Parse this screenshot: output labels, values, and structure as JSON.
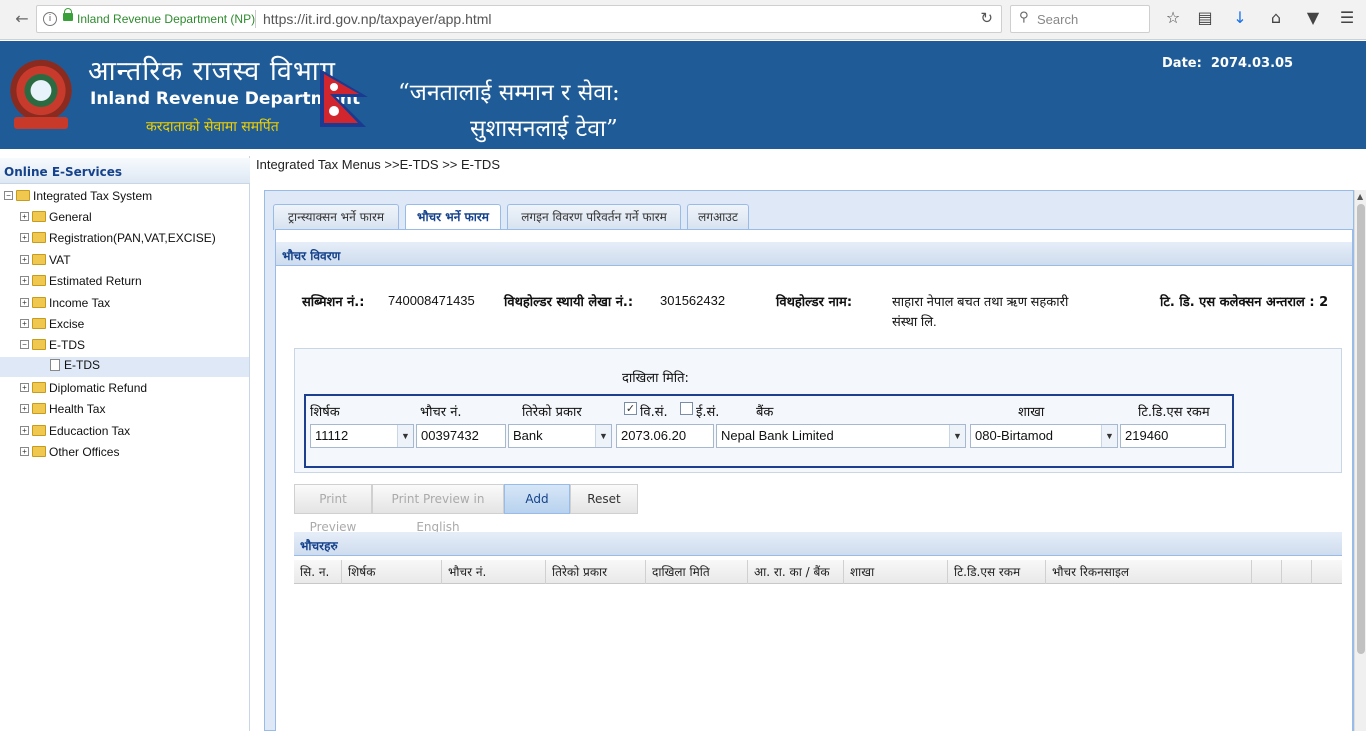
{
  "browser": {
    "site_identity": "Inland Revenue Department (NP)",
    "url": "https://it.ird.gov.np/taxpayer/app.html",
    "search_placeholder": "Search"
  },
  "header": {
    "title_np": "आन्तरिक राजस्व विभाग",
    "title_en": "Inland Revenue Department",
    "subtitle_np": "करदाताको सेवामा समर्पित",
    "slogan_line1": "“जनतालाई सम्मान र सेवा:",
    "slogan_line2": "सुशासनलाई टेवा”",
    "date_label": "Date:",
    "date_value": "2074.03.05"
  },
  "sidebar": {
    "title": "Online E-Services",
    "root": "Integrated Tax System",
    "items": [
      {
        "label": "General"
      },
      {
        "label": "Registration(PAN,VAT,EXCISE)"
      },
      {
        "label": "VAT"
      },
      {
        "label": "Estimated Return"
      },
      {
        "label": "Income Tax"
      },
      {
        "label": "Excise"
      },
      {
        "label": "E-TDS",
        "expanded": true
      },
      {
        "label": "E-TDS",
        "selected": true
      },
      {
        "label": "Diplomatic Refund"
      },
      {
        "label": "Health Tax"
      },
      {
        "label": "Educaction Tax"
      },
      {
        "label": "Other Offices"
      }
    ]
  },
  "breadcrumb": "Integrated Tax Menus >>E-TDS >> E-TDS",
  "tabs": [
    {
      "label": "ट्रान्स्याक्सन भर्ने फारम"
    },
    {
      "label": "भौचर भर्ने फारम",
      "active": true
    },
    {
      "label": "लगइन विवरण परिवर्तन गर्ने फारम"
    },
    {
      "label": "लगआउट"
    }
  ],
  "voucher_section": {
    "title": "भौचर विवरण",
    "submission_label": "सब्मिशन नं.:",
    "submission_value": "740008471435",
    "withholder_pan_label": "विथहोल्डर स्थायी लेखा नं.:",
    "withholder_pan_value": "301562432",
    "withholder_name_label": "विथहोल्डर नाम:",
    "withholder_name_line1": "साहारा नेपाल बचत तथा ऋण सहकारी",
    "withholder_name_line2": "संस्था लि.",
    "collection_period_label": "टि. डि. एस कलेक्सन अन्तराल : 2"
  },
  "form": {
    "deposit_date_label": "दाखिला मिति:",
    "heading_label": "शिर्षक",
    "heading_value": "11112",
    "voucher_no_label": "भौचर नं.",
    "voucher_no_value": "00397432",
    "payment_type_label": "तिरेको प्रकार",
    "payment_type_value": "Bank",
    "bs_label": "वि.सं.",
    "bs_checked": true,
    "ad_label": "ई.सं.",
    "ad_checked": false,
    "date_value": "2073.06.20",
    "bank_label": "बैंक",
    "bank_value": "Nepal Bank Limited",
    "branch_label": "शाखा",
    "branch_value": "080-Birtamod",
    "tds_amount_label": "टि.डि.एस रकम",
    "tds_amount_value": "219460"
  },
  "buttons": {
    "print_preview": "Print Preview",
    "print_preview_english": "Print Preview in English",
    "add": "Add",
    "reset": "Reset"
  },
  "vouchers_grid": {
    "title": "भौचरहरु",
    "columns": [
      "सि. न.",
      "शिर्षक",
      "भौचर नं.",
      "तिरेको प्रकार",
      "दाखिला मिति",
      "आ. रा. का / बैंक",
      "शाखा",
      "टि.डि.एस रकम",
      "भौचर रिकनसाइल"
    ],
    "rows": []
  }
}
